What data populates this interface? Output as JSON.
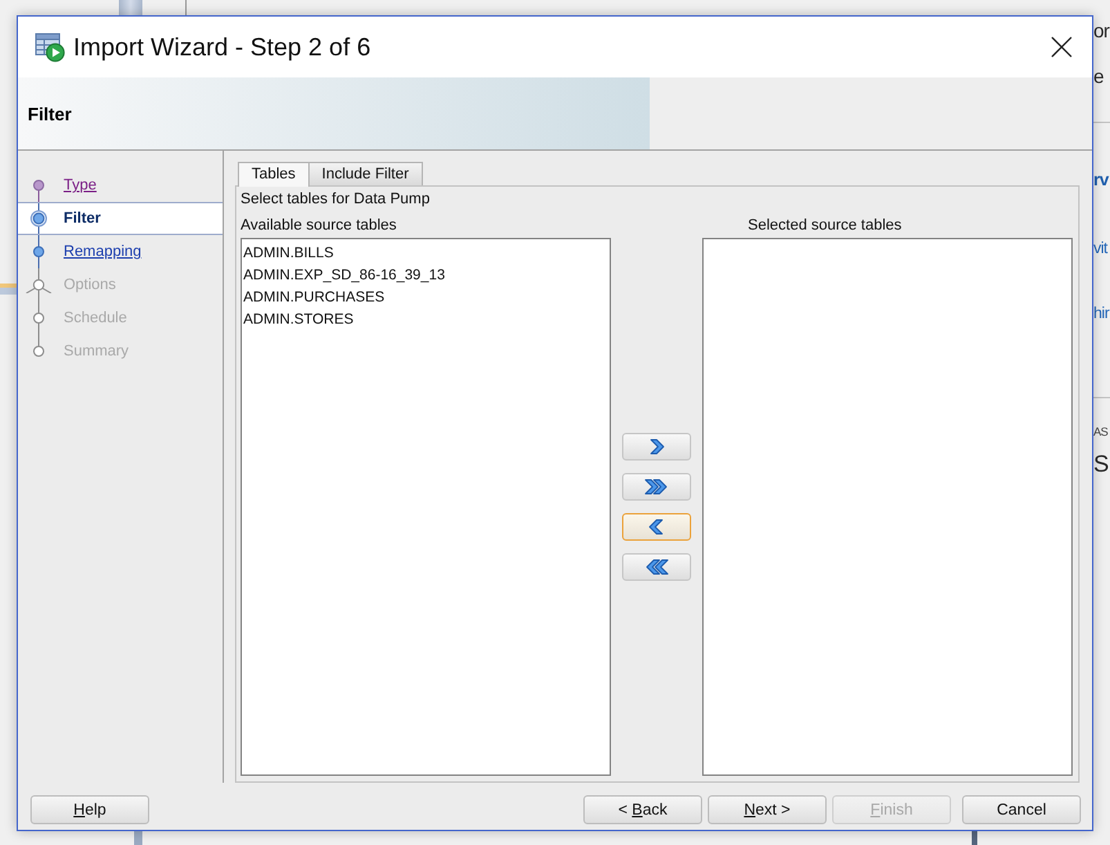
{
  "backdrop": {
    "fragments": [
      {
        "text": "or",
        "kind": "heading"
      },
      {
        "text": "e",
        "kind": "heading"
      },
      {
        "text": "rv",
        "kind": "subheading"
      },
      {
        "text": "vit",
        "kind": "link"
      },
      {
        "text": "hir",
        "kind": "link"
      },
      {
        "text": "AS",
        "kind": "caption"
      },
      {
        "text": "S",
        "kind": "heading"
      }
    ]
  },
  "window": {
    "title": "Import Wizard - Step 2 of 6"
  },
  "header": {
    "title": "Filter"
  },
  "steps": [
    {
      "label": "Type",
      "selected": false,
      "visited": true,
      "disabled": false,
      "branch": false
    },
    {
      "label": "Filter",
      "selected": true,
      "visited": false,
      "disabled": false,
      "branch": false
    },
    {
      "label": "Remapping",
      "selected": false,
      "visited": false,
      "disabled": false,
      "branch": false
    },
    {
      "label": "Options",
      "selected": false,
      "visited": false,
      "disabled": true,
      "branch": true
    },
    {
      "label": "Schedule",
      "selected": false,
      "visited": false,
      "disabled": true,
      "branch": false
    },
    {
      "label": "Summary",
      "selected": false,
      "visited": false,
      "disabled": true,
      "branch": false
    }
  ],
  "tabs": [
    {
      "label": "Tables",
      "selected": true
    },
    {
      "label": "Include Filter",
      "selected": false
    }
  ],
  "instruction": "Select tables for Data Pump",
  "available": {
    "label": "Available source tables",
    "items": [
      {
        "text": "ADMIN.BILLS",
        "selected": false
      },
      {
        "text": "ADMIN.EXP_SD_86-16_39_13",
        "selected": false
      },
      {
        "text": "ADMIN.PURCHASES",
        "selected": false
      },
      {
        "text": "ADMIN.STORES",
        "selected": false
      }
    ]
  },
  "chosen": {
    "label": "Selected source tables"
  },
  "move_buttons": [
    {
      "kind": "right",
      "focused": false
    },
    {
      "kind": "all-right",
      "focused": false
    },
    {
      "kind": "left",
      "focused": true
    },
    {
      "kind": "all-left",
      "focused": false
    }
  ],
  "footer": {
    "left_buttons": [
      {
        "key": "H",
        "post": "elp",
        "disabled": false
      }
    ],
    "right_buttons": [
      {
        "pre": "< ",
        "key": "B",
        "post": "ack",
        "disabled": false
      },
      {
        "key": "N",
        "post": "ext >",
        "disabled": false
      },
      {
        "key": "F",
        "post": "inish",
        "disabled": true
      },
      {
        "post": "Cancel",
        "disabled": false
      }
    ]
  }
}
